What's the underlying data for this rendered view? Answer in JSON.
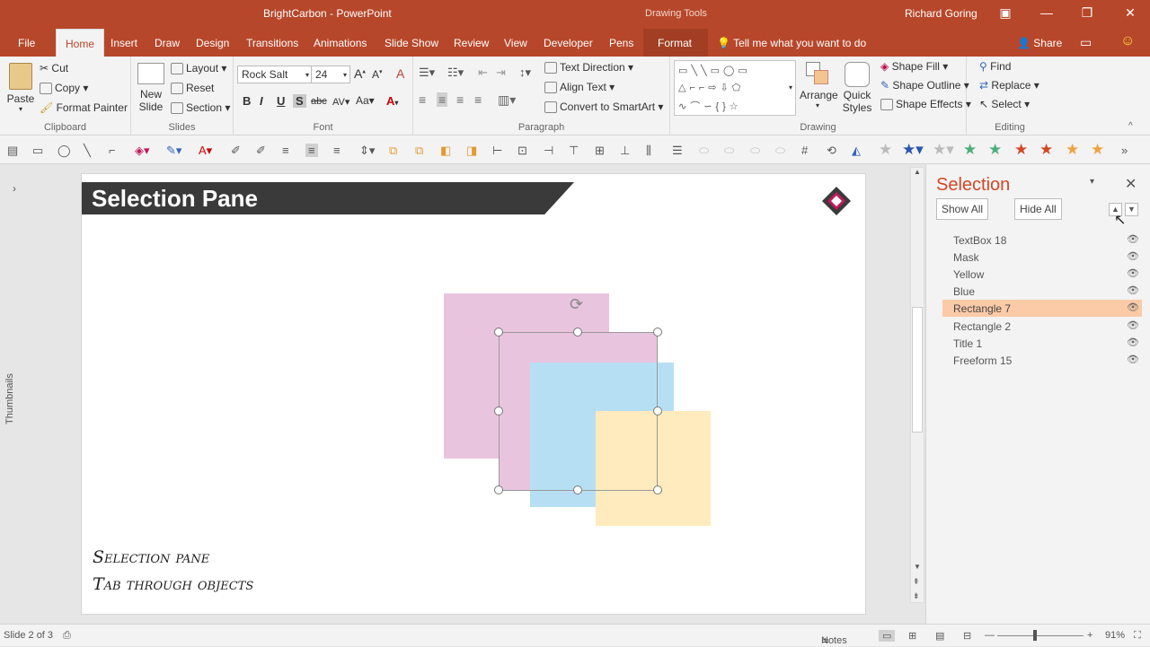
{
  "window": {
    "title": "BrightCarbon - PowerPoint",
    "context_group": "Drawing Tools",
    "user": "Richard Goring"
  },
  "tabs": {
    "file": "File",
    "home": "Home",
    "insert": "Insert",
    "draw": "Draw",
    "design": "Design",
    "transitions": "Transitions",
    "animations": "Animations",
    "slideshow": "Slide Show",
    "review": "Review",
    "view": "View",
    "developer": "Developer",
    "pens": "Pens",
    "format": "Format",
    "tell_me": "Tell me what you want to do",
    "share": "Share"
  },
  "ribbon": {
    "clipboard": {
      "label": "Clipboard",
      "paste": "Paste",
      "cut": "Cut",
      "copy": "Copy",
      "format_painter": "Format Painter"
    },
    "slides": {
      "label": "Slides",
      "new_slide_1": "New",
      "new_slide_2": "Slide",
      "layout": "Layout",
      "reset": "Reset",
      "section": "Section"
    },
    "font": {
      "label": "Font",
      "family": "Rock Salt",
      "size": "24"
    },
    "paragraph": {
      "label": "Paragraph",
      "text_direction": "Text Direction",
      "align_text": "Align Text",
      "smartart": "Convert to SmartArt"
    },
    "drawing": {
      "label": "Drawing",
      "arrange": "Arrange",
      "quick_styles_1": "Quick",
      "quick_styles_2": "Styles",
      "shape_fill": "Shape Fill",
      "shape_outline": "Shape Outline",
      "shape_effects": "Shape Effects"
    },
    "editing": {
      "label": "Editing",
      "find": "Find",
      "replace": "Replace",
      "select": "Select"
    }
  },
  "thumbnails_label": "Thumbnails",
  "slide": {
    "title": "Selection Pane",
    "note_line1": "Selection pane",
    "note_line2": "Tab through objects"
  },
  "selection_pane": {
    "title": "Selection",
    "show_all": "Show All",
    "hide_all": "Hide All",
    "items": [
      {
        "label": "TextBox 18"
      },
      {
        "label": "Mask"
      },
      {
        "label": "Yellow"
      },
      {
        "label": "Blue"
      },
      {
        "label": "Rectangle 7",
        "selected": true
      },
      {
        "label": "Rectangle 2"
      },
      {
        "label": "Title 1"
      },
      {
        "label": "Freeform 15"
      }
    ]
  },
  "status": {
    "slide": "Slide 2 of 3",
    "notes": "Notes",
    "zoom": "91%"
  },
  "colors": {
    "accent": "#b7472a",
    "pink": "#e9c4de",
    "blue": "#b7dff4",
    "yellow": "#ffebbd",
    "selected_row": "#fbcaa7"
  }
}
